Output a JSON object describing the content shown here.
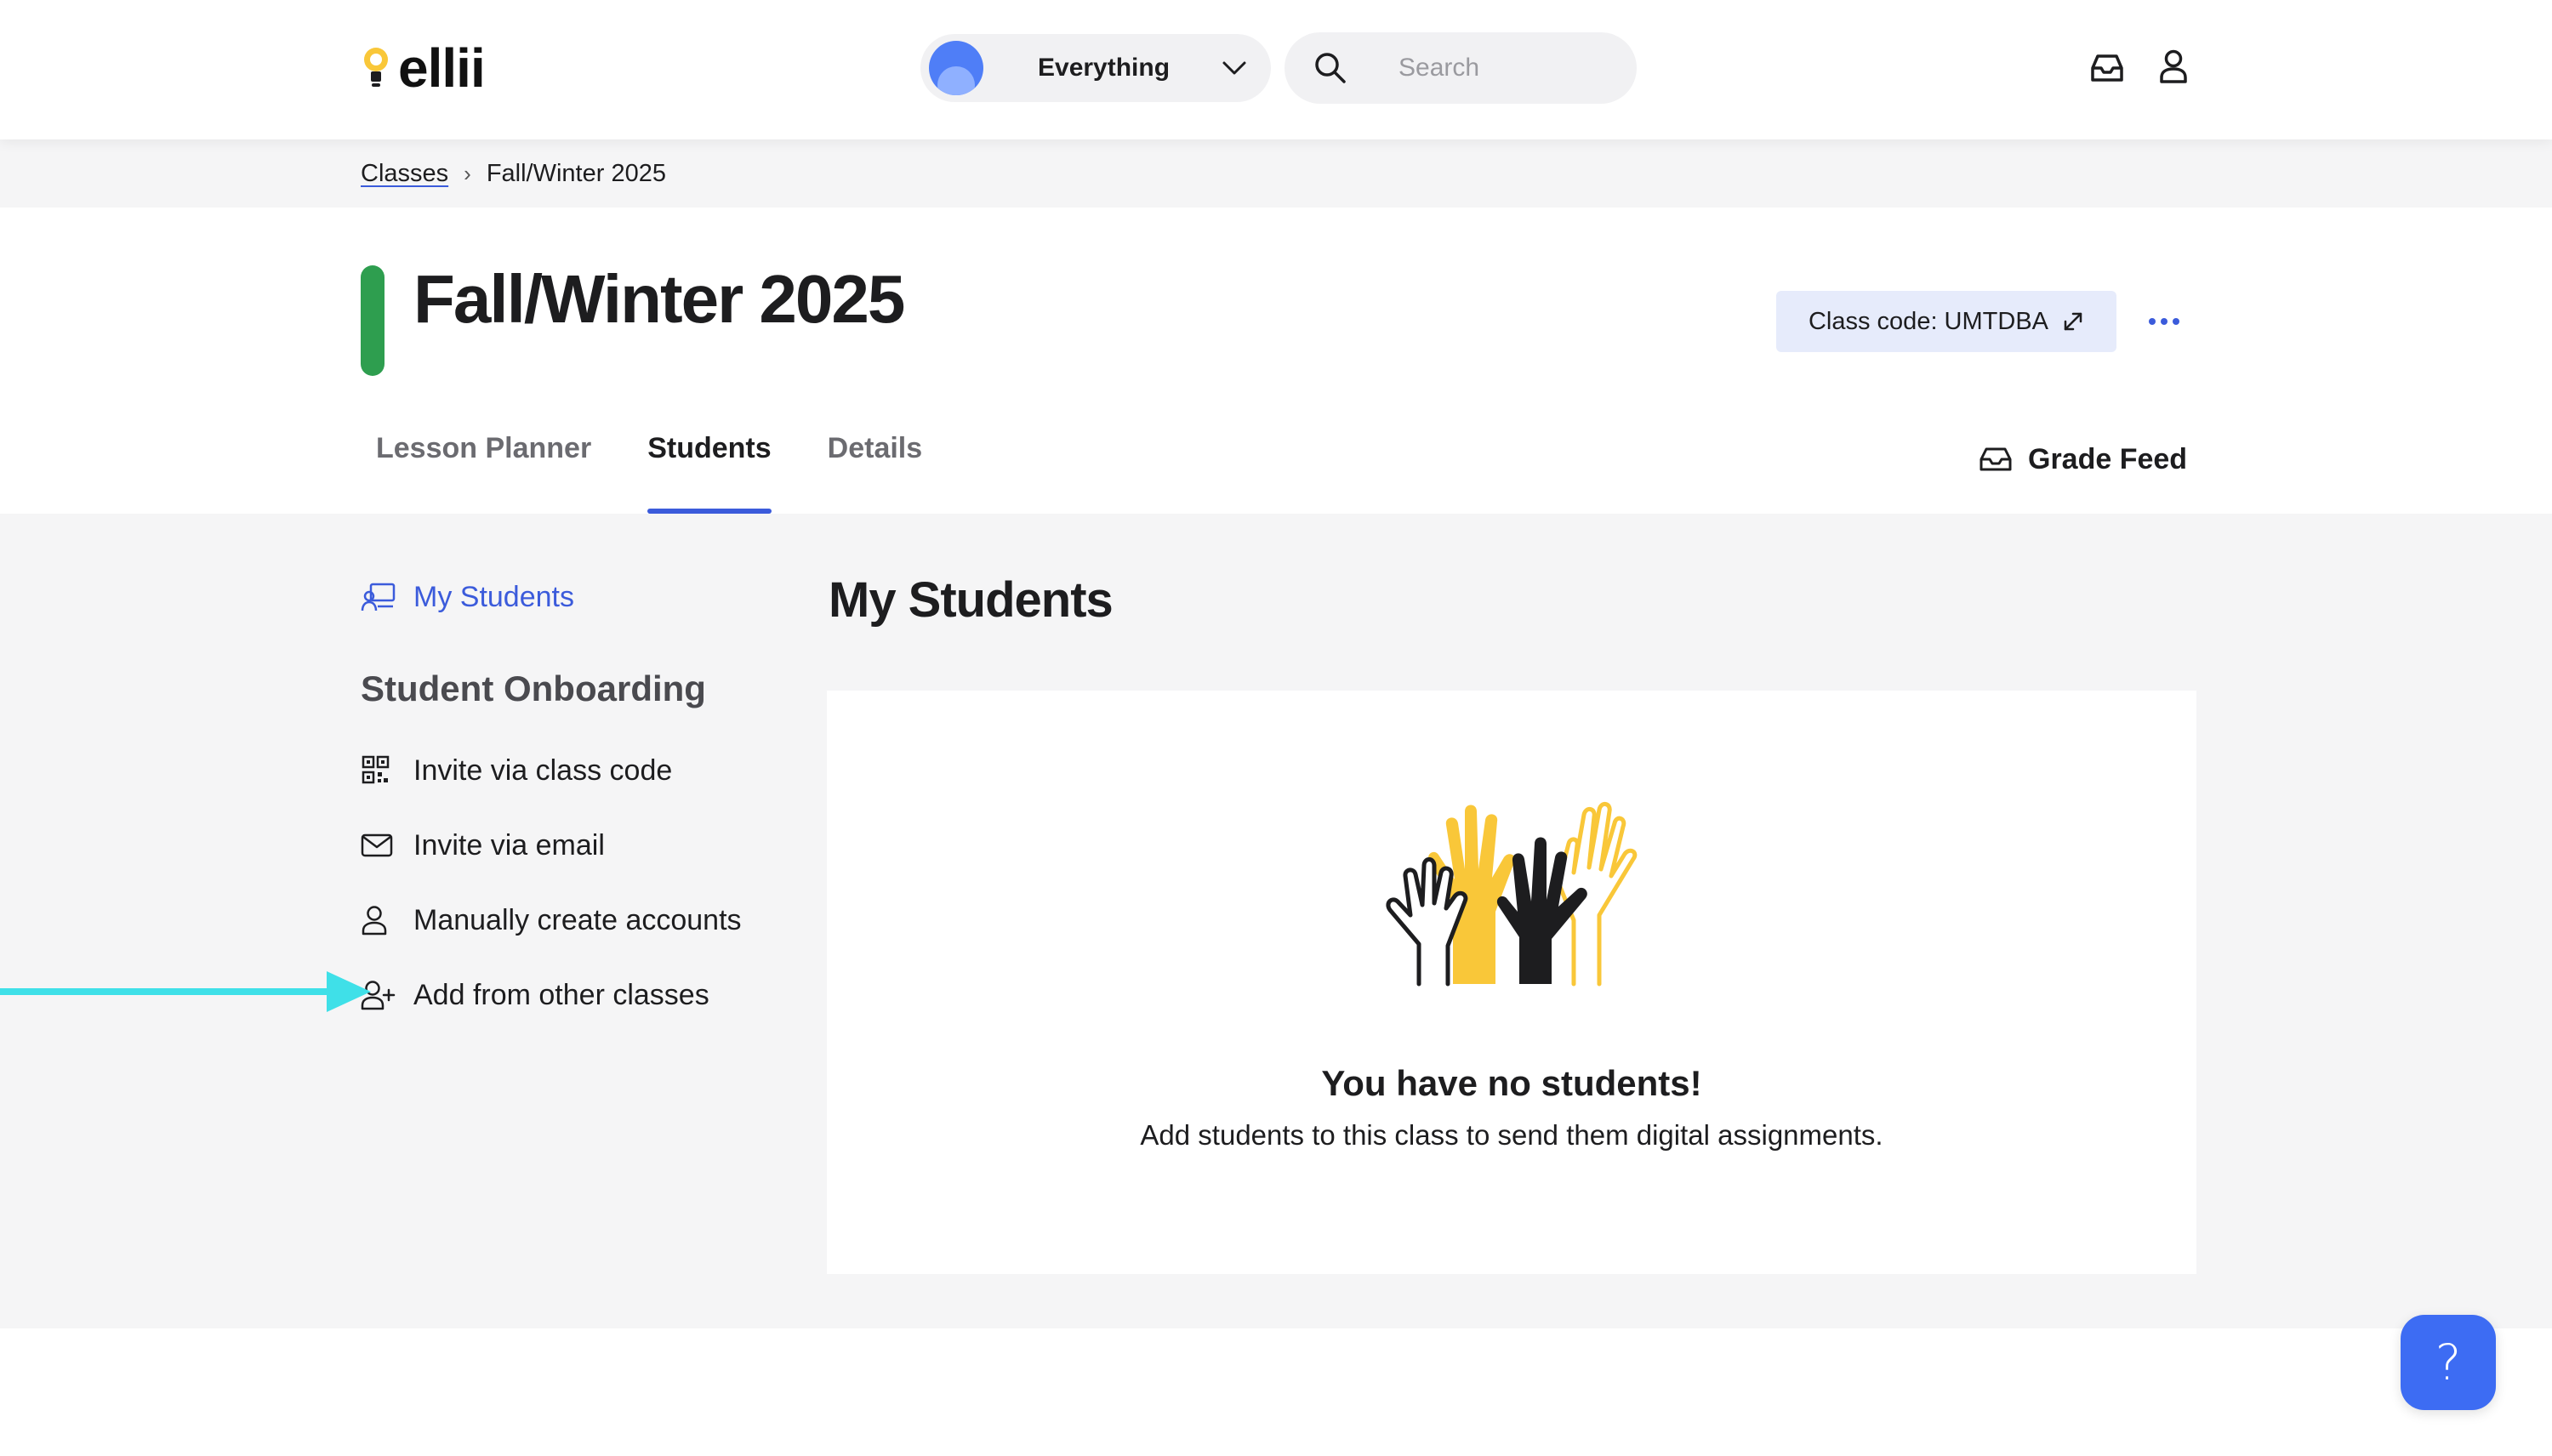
{
  "header": {
    "logo_text": "ellii",
    "scope_select": {
      "value": "Everything"
    },
    "search": {
      "placeholder": "Search"
    }
  },
  "breadcrumb": {
    "parent": "Classes",
    "separator": "›",
    "current": "Fall/Winter 2025"
  },
  "page": {
    "title": "Fall/Winter 2025",
    "class_color": "#2e9e4f",
    "class_code_label": "Class code: UMTDBA"
  },
  "tabs": [
    {
      "label": "Lesson Planner",
      "active": false
    },
    {
      "label": "Students",
      "active": true
    },
    {
      "label": "Details",
      "active": false
    }
  ],
  "grade_feed_label": "Grade Feed",
  "sidebar": {
    "my_students": "My Students",
    "onboarding_heading": "Student Onboarding",
    "items": [
      {
        "label": "Invite via class code",
        "icon": "qr-code-icon"
      },
      {
        "label": "Invite via email",
        "icon": "envelope-icon"
      },
      {
        "label": "Manually create accounts",
        "icon": "user-icon"
      },
      {
        "label": "Add from other classes",
        "icon": "user-plus-icon"
      }
    ]
  },
  "main": {
    "title": "My Students",
    "empty_title": "You have no students!",
    "empty_subtitle": "Add students to this class to send them digital assignments."
  },
  "help": {
    "glyph": "?"
  },
  "colors": {
    "accent": "#3b5bdb",
    "help_button": "#3d6cf3",
    "annotation_arrow": "#3fe0e8",
    "hands_yellow": "#f9c739",
    "hands_black": "#1d1d1f"
  }
}
